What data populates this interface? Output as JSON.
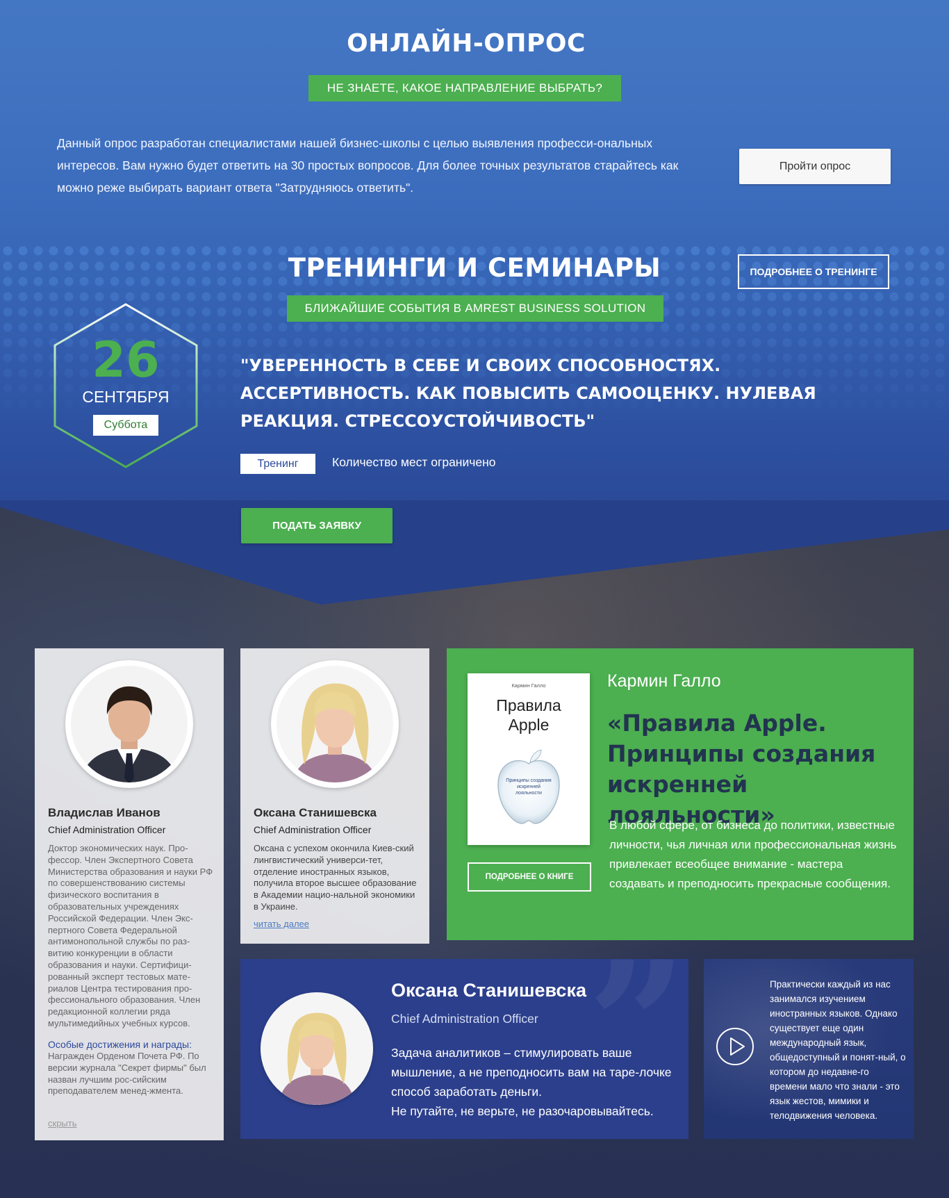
{
  "survey": {
    "title": "ОНЛАЙН-ОПРОС",
    "tag": "НЕ ЗНАЕТЕ, КАКОЕ НАПРАВЛЕНИЕ ВЫБРАТЬ?",
    "description": "Данный опрос разработан специалистами нашей бизнес-школы с целью выявления професси-ональных интересов. Вам нужно будет ответить на 30 простых вопросов. Для более точных результатов старайтесь как можно реже выбирать вариант ответа \"Затрудняюсь ответить\".",
    "button_label": "Пройти опрос"
  },
  "trainings": {
    "title": "ТРЕНИНГИ И СЕМИНАРЫ",
    "more_button_label": "ПОДРОБНЕЕ О ТРЕНИНГЕ",
    "events_tag": "БЛИЖАЙШИЕ СОБЫТИЯ В AMREST BUSINESS SOLUTION",
    "event": {
      "day": "26",
      "month": "СЕНТЯБРЯ",
      "weekday": "Суббота",
      "title": "\"УВЕРЕННОСТЬ В СЕБЕ И СВОИХ СПОСОБНОСТЯХ. АССЕРТИВНОСТЬ. КАК ПОВЫСИТЬ САМООЦЕНКУ. НУЛЕВАЯ РЕАКЦИЯ. СТРЕССОУСТОЙЧИВОСТЬ\"",
      "type": "Тренинг",
      "seats": "Количество мест ограничено",
      "apply_label": "ПОДАТЬ ЗАЯВКУ"
    }
  },
  "speakers": [
    {
      "name": "Владислав Иванов",
      "role": "Chief Administration Officer",
      "bio": "Доктор экономических наук. Про-фессор. Член Экспертного Совета Министерства образования и науки РФ по совершенствованию системы физического воспитания в образовательных учреждениях Российской Федерации. Член Экс-пертного Совета Федеральной антимонопольной службы по раз-витию конкуренции в области образования и науки. Сертифици-рованный эксперт тестовых мате-риалов Центра тестирования про-фессионального образования. Член редакционной коллегии ряда мультимедийных учебных курсов.",
      "awards_title": "Особые достижения и награды",
      "awards_text": "Награжден Орденом Почета РФ. По версии журнала \"Секрет фирмы\" был назван лучшим рос-сийским преподавателем менед-жмента.",
      "link_label": "скрыть"
    },
    {
      "name": "Оксана Станишевска",
      "role": "Chief Administration Officer",
      "bio": "Оксана с успехом окончила Киев-ский лингвистический универси-тет, отделение иностранных языков, получила второе высшее образование в Академии нацио-нальной экономики в Украине.",
      "link_label": "читать далее"
    }
  ],
  "book": {
    "cover_author": "Кармин Галло",
    "cover_title_line1": "Правила",
    "cover_title_line2": "Apple",
    "cover_subtitle": "Принципы создания искренней лояльности",
    "more_button_label": "ПОДРОБНЕЕ О КНИГЕ",
    "author": "Кармин Галло",
    "title": "«Правила Apple. Принципы создания искренней лояльности»",
    "description": "В любой сфере, от бизнеса до политики, известные личности, чья личная или профессиональная жизнь привлекает всеобщее внимание - мастера создавать и преподносить прекрасные сообщения."
  },
  "testimonial": {
    "name": "Оксана Станишевска",
    "role": "Chief Administration Officer",
    "text": "Задача аналитиков – стимулировать ваше мышление, а не преподносить вам на таре-лочке способ заработать деньги.",
    "text2": "Не путайте, не верьте, не разочаровывайтесь."
  },
  "video": {
    "text": "Практически каждый из нас занимался изучением иностранных языков. Однако существует еще один международный язык, общедоступный и понят-ный, о котором до недавне-го времени мало что знали - это язык жестов, мимики и телодвижения человека."
  },
  "colors": {
    "green": "#4caf50",
    "blue_top": "#4477c3",
    "blue_dark": "#2c3f8c",
    "navy_text": "#22344f"
  }
}
